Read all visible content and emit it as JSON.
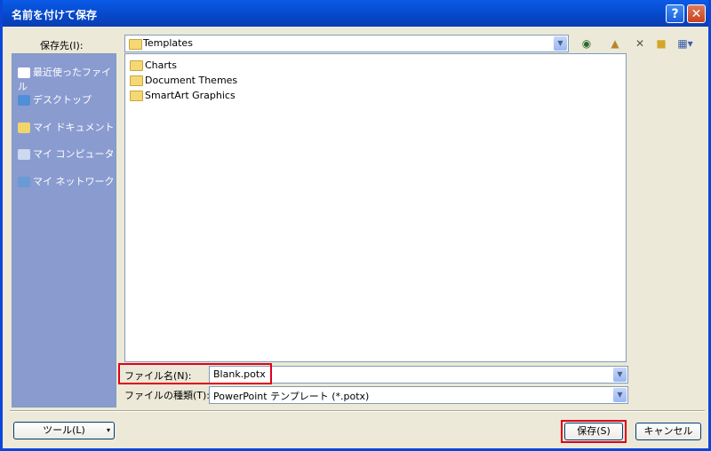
{
  "window": {
    "title": "名前を付けて保存",
    "help_glyph": "?",
    "close_glyph": "✕"
  },
  "location": {
    "label": "保存先(I):",
    "value": "Templates"
  },
  "toolbar": {
    "icons": [
      "back-icon",
      "up-folder-icon",
      "delete-icon",
      "new-folder-icon",
      "views-icon"
    ]
  },
  "places": [
    {
      "label": "最近使ったファイル",
      "icon": "recent-docs-icon"
    },
    {
      "label": "デスクトップ",
      "icon": "desktop-icon"
    },
    {
      "label": "マイ ドキュメント",
      "icon": "my-documents-icon"
    },
    {
      "label": "マイ コンピュータ",
      "icon": "my-computer-icon"
    },
    {
      "label": "マイ ネットワーク",
      "icon": "my-network-icon"
    }
  ],
  "files": [
    {
      "name": "Charts",
      "icon": "folder-icon"
    },
    {
      "name": "Document Themes",
      "icon": "folder-icon"
    },
    {
      "name": "SmartArt Graphics",
      "icon": "folder-icon"
    }
  ],
  "filename": {
    "label": "ファイル名(N):",
    "value": "Blank.potx"
  },
  "filetype": {
    "label": "ファイルの種類(T):",
    "value": "PowerPoint テンプレート (*.potx)"
  },
  "buttons": {
    "tools": "ツール(L)",
    "save": "保存(S)",
    "cancel": "キャンセル"
  },
  "colors": {
    "titlebar": "#0a50d8",
    "highlight": "#e0001a",
    "places_panel": "#8a9bd0"
  }
}
